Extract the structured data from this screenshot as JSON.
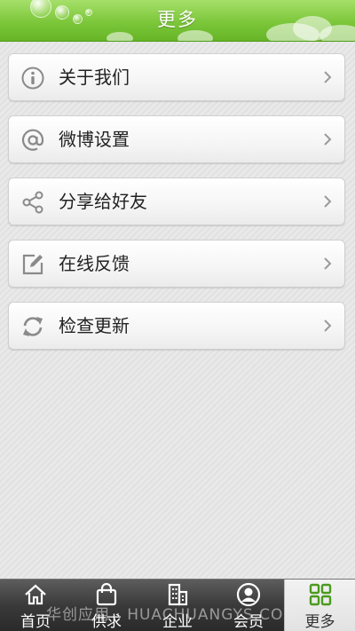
{
  "header": {
    "title": "更多"
  },
  "menu": {
    "items": [
      {
        "label": "关于我们",
        "icon": "info-icon"
      },
      {
        "label": "微博设置",
        "icon": "at-icon"
      },
      {
        "label": "分享给好友",
        "icon": "share-icon"
      },
      {
        "label": "在线反馈",
        "icon": "edit-icon"
      },
      {
        "label": "检查更新",
        "icon": "refresh-icon"
      }
    ]
  },
  "tabbar": {
    "items": [
      {
        "label": "首页",
        "icon": "home-icon"
      },
      {
        "label": "供求",
        "icon": "bag-icon"
      },
      {
        "label": "企业",
        "icon": "building-icon"
      },
      {
        "label": "会员",
        "icon": "user-icon"
      },
      {
        "label": "更多",
        "icon": "grid-icon"
      }
    ],
    "active_index": 4
  },
  "watermark": "华创应用 · HUACHUANGYS.COM",
  "colors": {
    "header_green": "#7cc63a",
    "active_tab_icon": "#4a9a1e"
  }
}
